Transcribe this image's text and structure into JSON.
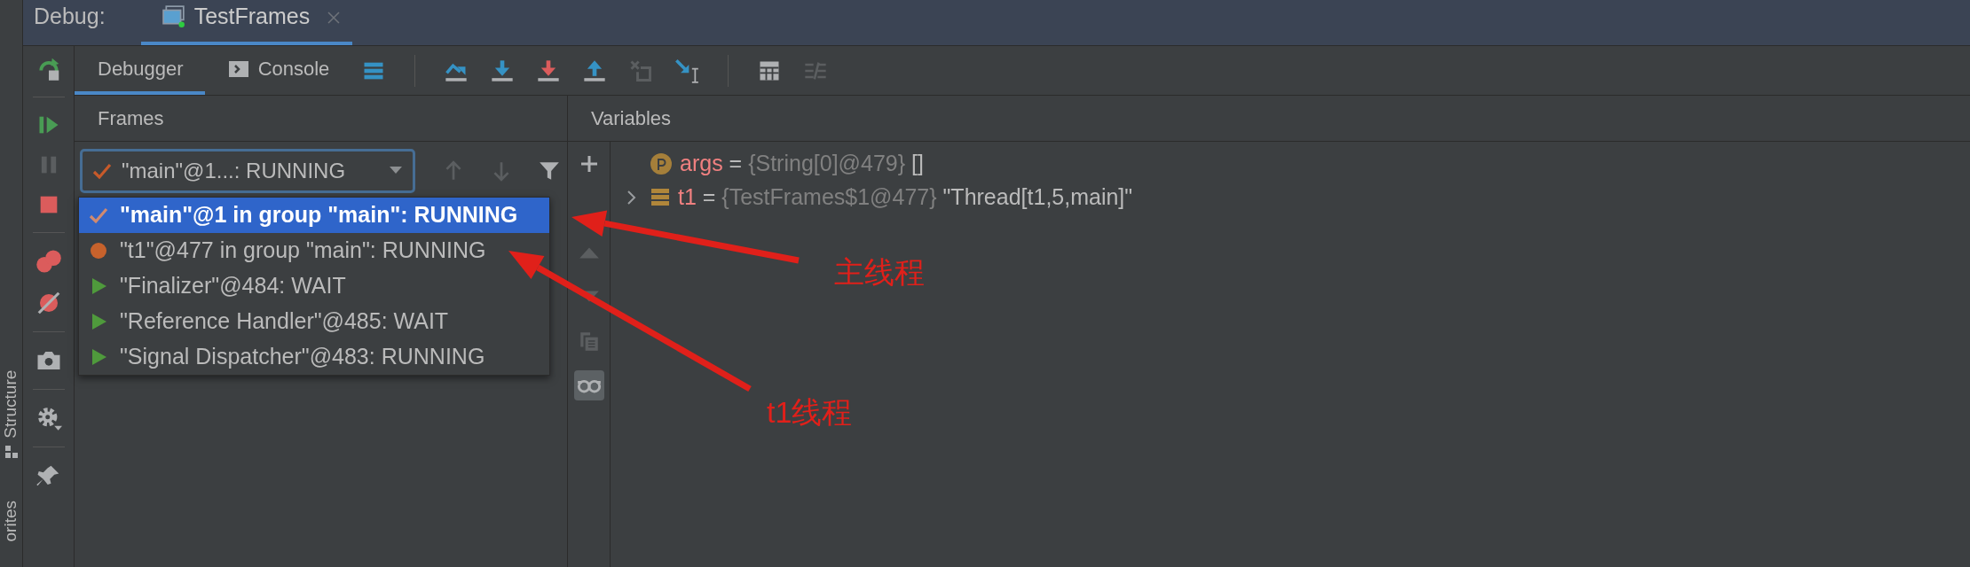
{
  "side_strip": {
    "labels": [
      "Structure",
      "orites"
    ]
  },
  "debug_bar": {
    "label": "Debug:",
    "tabs": [
      {
        "label": "TestFrames",
        "selected": true
      }
    ]
  },
  "left_actions": [
    {
      "kind": "rerun",
      "disabled": false
    },
    {
      "kind": "separator"
    },
    {
      "kind": "resume",
      "disabled": false
    },
    {
      "kind": "pause",
      "disabled": true
    },
    {
      "kind": "stop",
      "disabled": false
    },
    {
      "kind": "separator"
    },
    {
      "kind": "breakpoints",
      "disabled": false
    },
    {
      "kind": "mute",
      "disabled": false
    },
    {
      "kind": "separator"
    },
    {
      "kind": "camera",
      "disabled": false
    },
    {
      "kind": "separator"
    },
    {
      "kind": "settings",
      "disabled": false
    },
    {
      "kind": "separator"
    },
    {
      "kind": "pin",
      "disabled": false
    }
  ],
  "toolbar": {
    "tabs": [
      {
        "label": "Debugger",
        "selected": true,
        "kind": "plain"
      },
      {
        "label": "Console",
        "selected": false,
        "kind": "console"
      }
    ],
    "actions": [
      {
        "kind": "layout",
        "disabled": false
      },
      {
        "kind": "separator"
      },
      {
        "kind": "step-over",
        "disabled": false
      },
      {
        "kind": "step-into",
        "disabled": false
      },
      {
        "kind": "force-step-into",
        "disabled": false
      },
      {
        "kind": "step-out",
        "disabled": false
      },
      {
        "kind": "drop-frame",
        "disabled": true
      },
      {
        "kind": "run-to-cursor",
        "disabled": false
      },
      {
        "kind": "separator"
      },
      {
        "kind": "evaluate",
        "disabled": false
      },
      {
        "kind": "trace",
        "disabled": true
      }
    ]
  },
  "frames": {
    "title": "Frames",
    "thread_combo": {
      "value": "\"main\"@1...: RUNNING",
      "kind": "check"
    },
    "actions": [
      {
        "kind": "up",
        "disabled": true
      },
      {
        "kind": "down",
        "disabled": true
      },
      {
        "kind": "filter",
        "disabled": false
      }
    ],
    "thread_list": [
      {
        "label": "\"main\"@1 in group \"main\": RUNNING",
        "kind": "check",
        "selected": true
      },
      {
        "label": "\"t1\"@477 in group \"main\": RUNNING",
        "kind": "dot",
        "selected": false
      },
      {
        "label": "\"Finalizer\"@484: WAIT",
        "kind": "play",
        "selected": false
      },
      {
        "label": "\"Reference Handler\"@485: WAIT",
        "kind": "play",
        "selected": false
      },
      {
        "label": "\"Signal Dispatcher\"@483: RUNNING",
        "kind": "play",
        "selected": false
      }
    ]
  },
  "variables": {
    "title": "Variables",
    "actions": [
      {
        "kind": "plus",
        "disabled": false,
        "toggled": false
      },
      {
        "kind": "move-up",
        "disabled": true,
        "toggled": false
      },
      {
        "kind": "move-down",
        "disabled": true,
        "toggled": false
      },
      {
        "kind": "copy",
        "disabled": true,
        "toggled": false
      },
      {
        "kind": "watches",
        "disabled": false,
        "toggled": true
      }
    ],
    "items": [
      {
        "kind": "param",
        "name": "args",
        "equals": "=",
        "type": "{String[0]@479}",
        "value": "[]",
        "expandable": false
      },
      {
        "kind": "field",
        "name": "t1",
        "equals": "=",
        "type": "{TestFrames$1@477}",
        "value": "\"Thread[t1,5,main]\"",
        "expandable": true
      }
    ]
  },
  "annotations": [
    {
      "text": "主线程"
    },
    {
      "text": "t1线程"
    }
  ]
}
